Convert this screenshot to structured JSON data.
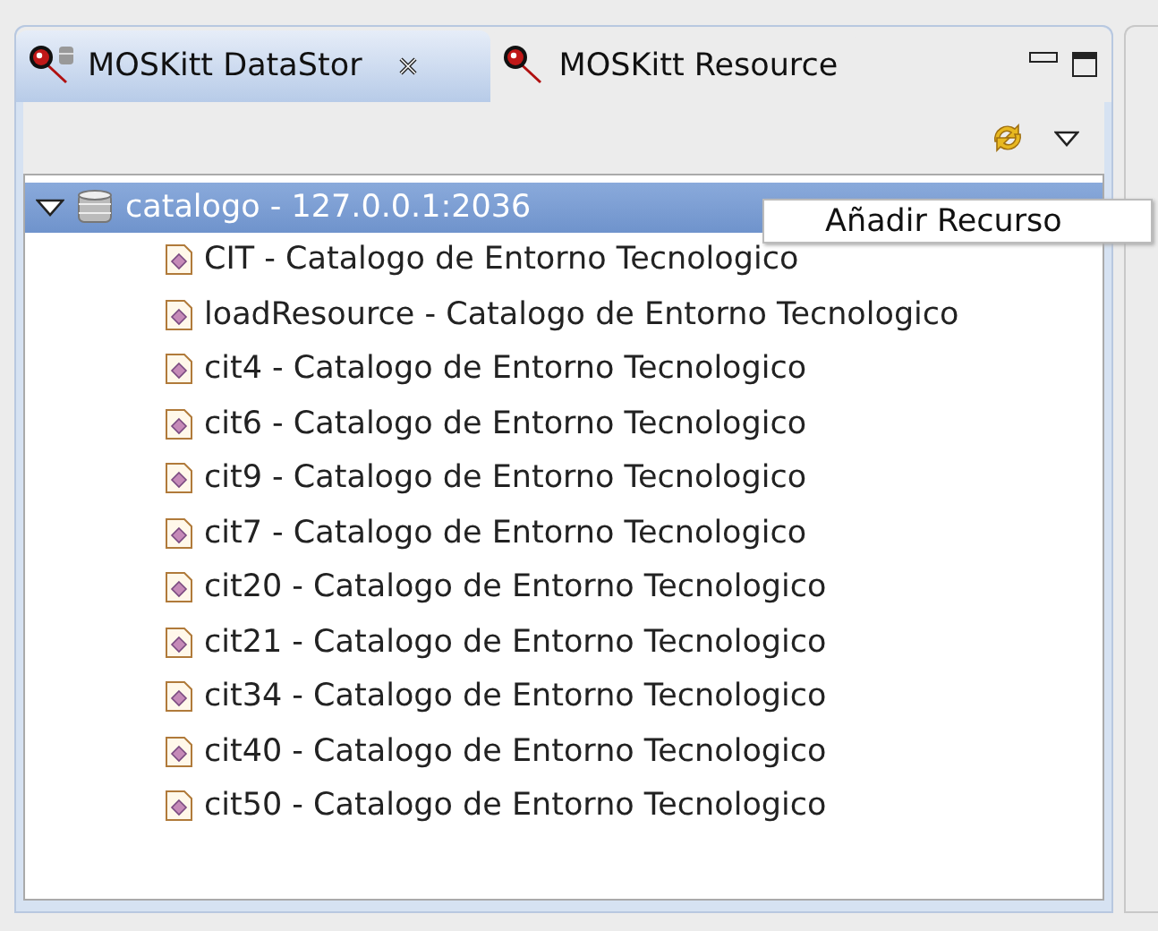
{
  "tabs": [
    {
      "label": "MOSKitt DataStor",
      "selected": true,
      "closable": true
    },
    {
      "label": "MOSKitt Resource",
      "selected": false,
      "closable": false
    }
  ],
  "tree": {
    "label": "catalogo - 127.0.0.1:2036",
    "expanded": true,
    "selected": true,
    "children": [
      {
        "label": "CIT - Catalogo de Entorno Tecnologico"
      },
      {
        "label": "loadResource - Catalogo de Entorno Tecnologico"
      },
      {
        "label": "cit4 - Catalogo de Entorno Tecnologico"
      },
      {
        "label": "cit6 - Catalogo de Entorno Tecnologico"
      },
      {
        "label": "cit9 - Catalogo de Entorno Tecnologico"
      },
      {
        "label": "cit7 - Catalogo de Entorno Tecnologico"
      },
      {
        "label": "cit20 - Catalogo de Entorno Tecnologico"
      },
      {
        "label": "cit21 - Catalogo de Entorno Tecnologico"
      },
      {
        "label": "cit34 - Catalogo de Entorno Tecnologico"
      },
      {
        "label": "cit40 - Catalogo de Entorno Tecnologico"
      },
      {
        "label": "cit50 - Catalogo de Entorno Tecnologico"
      }
    ]
  },
  "context_menu": {
    "items": [
      "Añadir Recurso"
    ]
  }
}
